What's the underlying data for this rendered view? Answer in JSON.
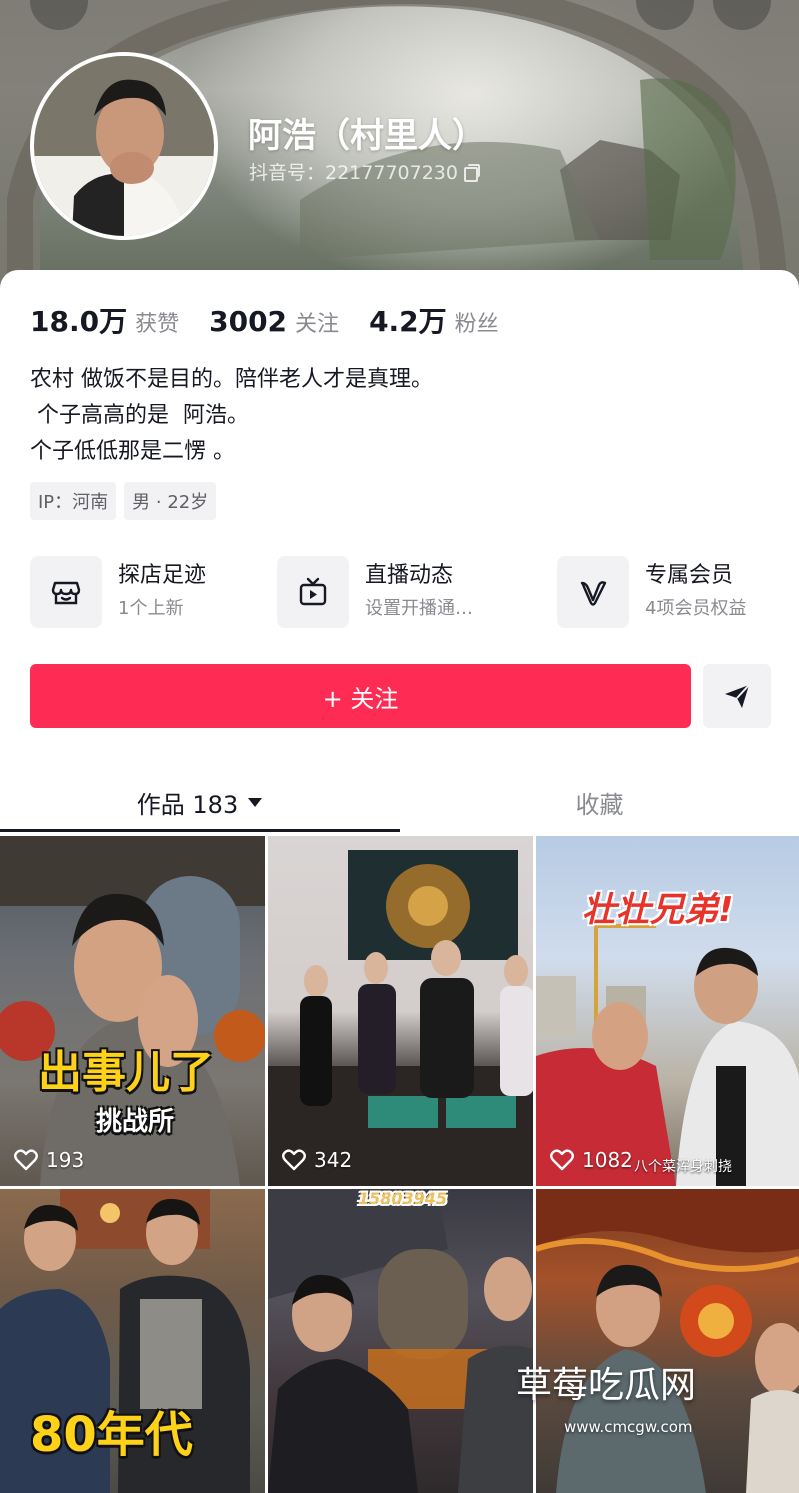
{
  "profile": {
    "nickname": "阿浩（村里人）",
    "douyin_id": "抖音号：22177707230"
  },
  "stats": [
    {
      "value": "18.0万",
      "label": "获赞"
    },
    {
      "value": "3002",
      "label": "关注"
    },
    {
      "value": "4.2万",
      "label": "粉丝"
    }
  ],
  "bio": [
    "农村 做饭不是目的。陪伴老人才是真理。",
    " 个子高高的是  阿浩。",
    "个子低低那是二愣 。"
  ],
  "tags": [
    "IP：河南",
    "男 · 22岁"
  ],
  "entries": [
    {
      "title": "探店足迹",
      "subtitle": "1个上新",
      "icon": "store-icon"
    },
    {
      "title": "直播动态",
      "subtitle": "设置开播通…",
      "icon": "tv-icon"
    },
    {
      "title": "专属会员",
      "subtitle": "4项会员权益",
      "icon": "v-badge-icon"
    }
  ],
  "follow_button": "+ 关注",
  "tabs": {
    "works": "作品 183",
    "collections": "收藏"
  },
  "videos": [
    {
      "likes": "193",
      "cover_text": "出事儿了",
      "cover_sub": "挑战所"
    },
    {
      "likes": "342"
    },
    {
      "likes": "1082",
      "cover_text": "壮壮兄弟!",
      "cover_sub": "八个菜浑身刺挠"
    },
    {
      "cover_text": "80年代"
    },
    {
      "sign_text": "15803945"
    },
    {}
  ],
  "watermark": {
    "text": "草莓吃瓜网",
    "url": "www.cmcgw.com"
  },
  "colors": {
    "accent": "#fe2c55",
    "text_primary": "#161823",
    "text_secondary": "#8a8b91"
  }
}
